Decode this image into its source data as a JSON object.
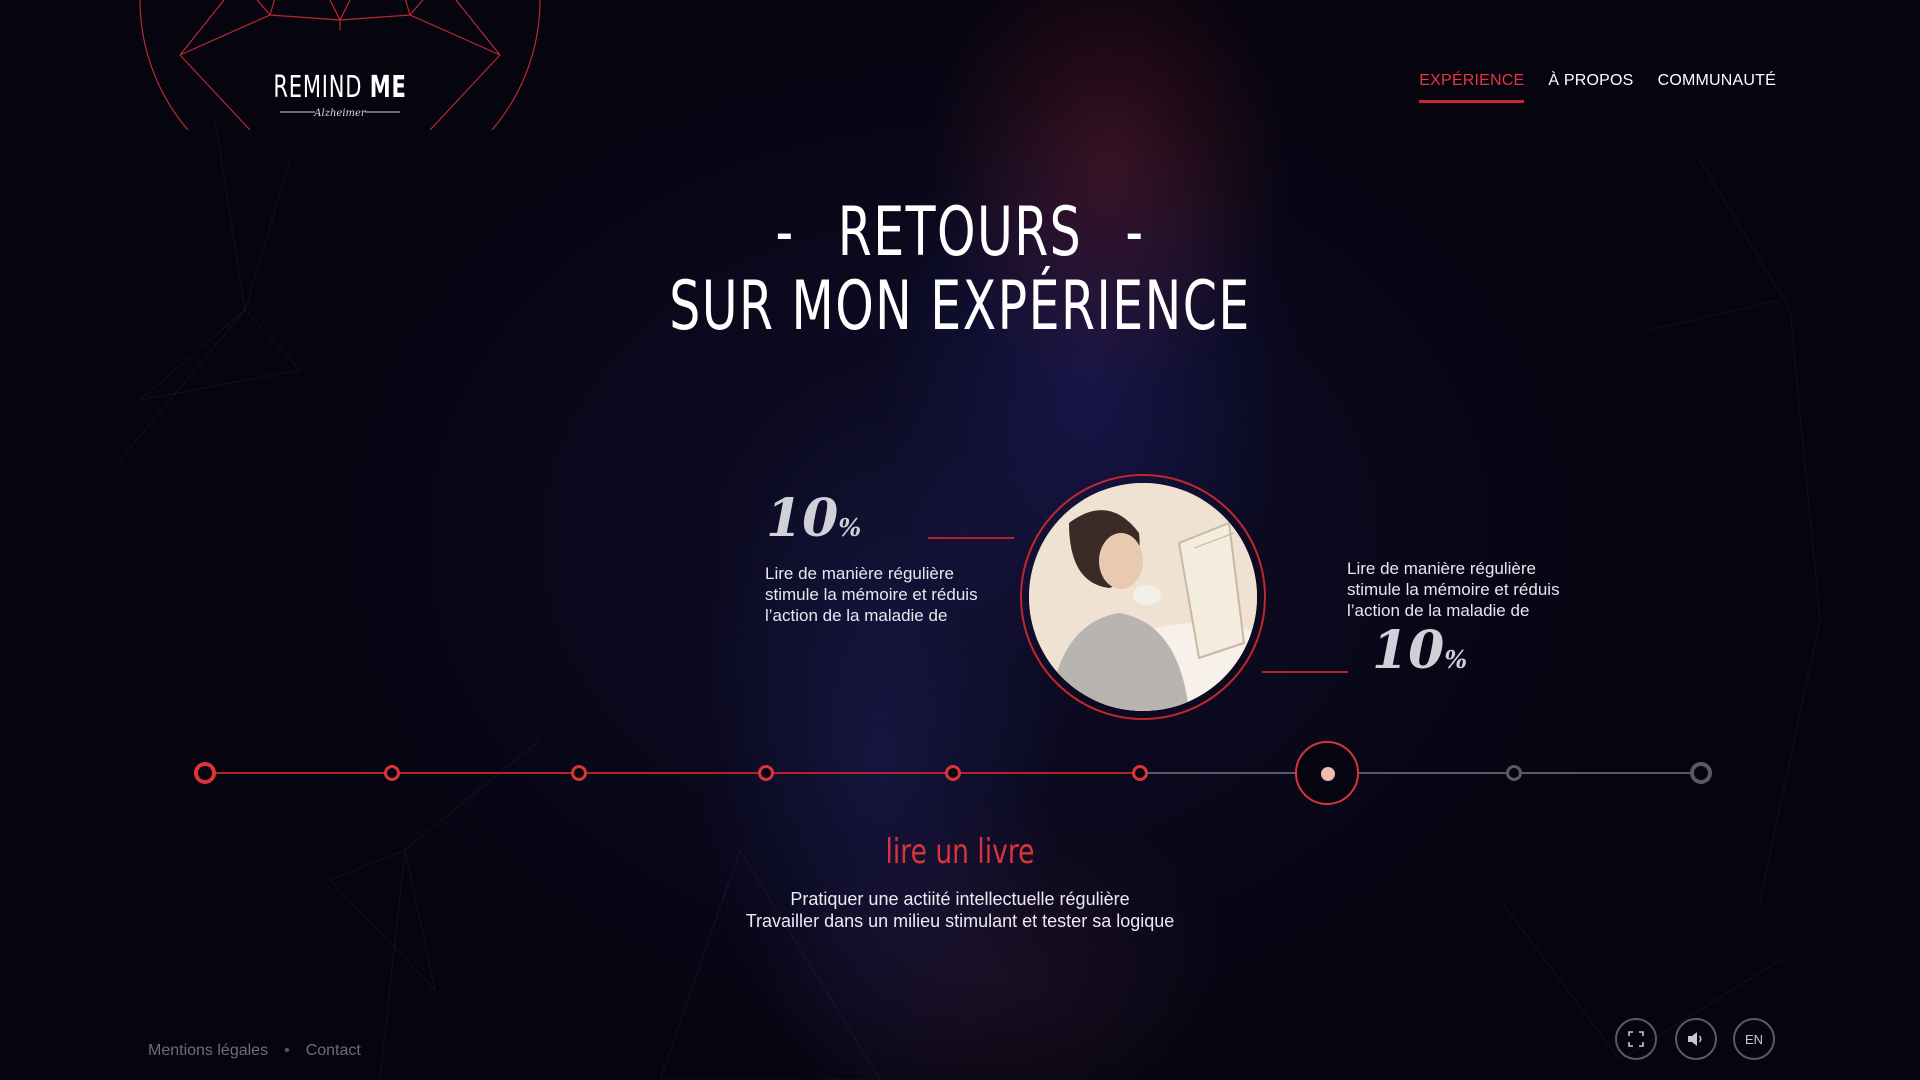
{
  "brand": {
    "name_light": "REMIND",
    "name_bold": "ME",
    "subtitle": "Alzheimer"
  },
  "nav": {
    "items": [
      {
        "label": "EXPÉRIENCE",
        "active": true
      },
      {
        "label": "À PROPOS",
        "active": false
      },
      {
        "label": "COMMUNAUTÉ",
        "active": false
      }
    ]
  },
  "title": {
    "dash": "-",
    "line1": "RETOURS",
    "line2": "SUR MON EXPÉRIENCE"
  },
  "stats": {
    "left": {
      "value": "10",
      "unit": "%",
      "text": "Lire de manière régulière stimule la mémoire et réduis l’action de la maladie de"
    },
    "right": {
      "value": "10",
      "unit": "%",
      "text": "Lire de manière régulière stimule la mémoire et réduis l’action de la maladie de"
    }
  },
  "portrait": {
    "icon": "woman-reading-photo"
  },
  "timeline": {
    "step_count": 9,
    "active_step": 6,
    "active_title": "lire un livre",
    "description_lines": [
      "Pratiquer une actiité intellectuelle régulière",
      "Travailler dans un milieu stimulant et tester sa logique"
    ]
  },
  "footer": {
    "links": [
      "Mentions légales",
      "Contact"
    ],
    "separator": "•"
  },
  "controls": {
    "fullscreen_icon": "fullscreen-icon",
    "sound_icon": "sound-icon",
    "language": "EN"
  },
  "colors": {
    "accent": "#d8343a",
    "background": "#05040f",
    "inactive": "#5a5a66"
  }
}
